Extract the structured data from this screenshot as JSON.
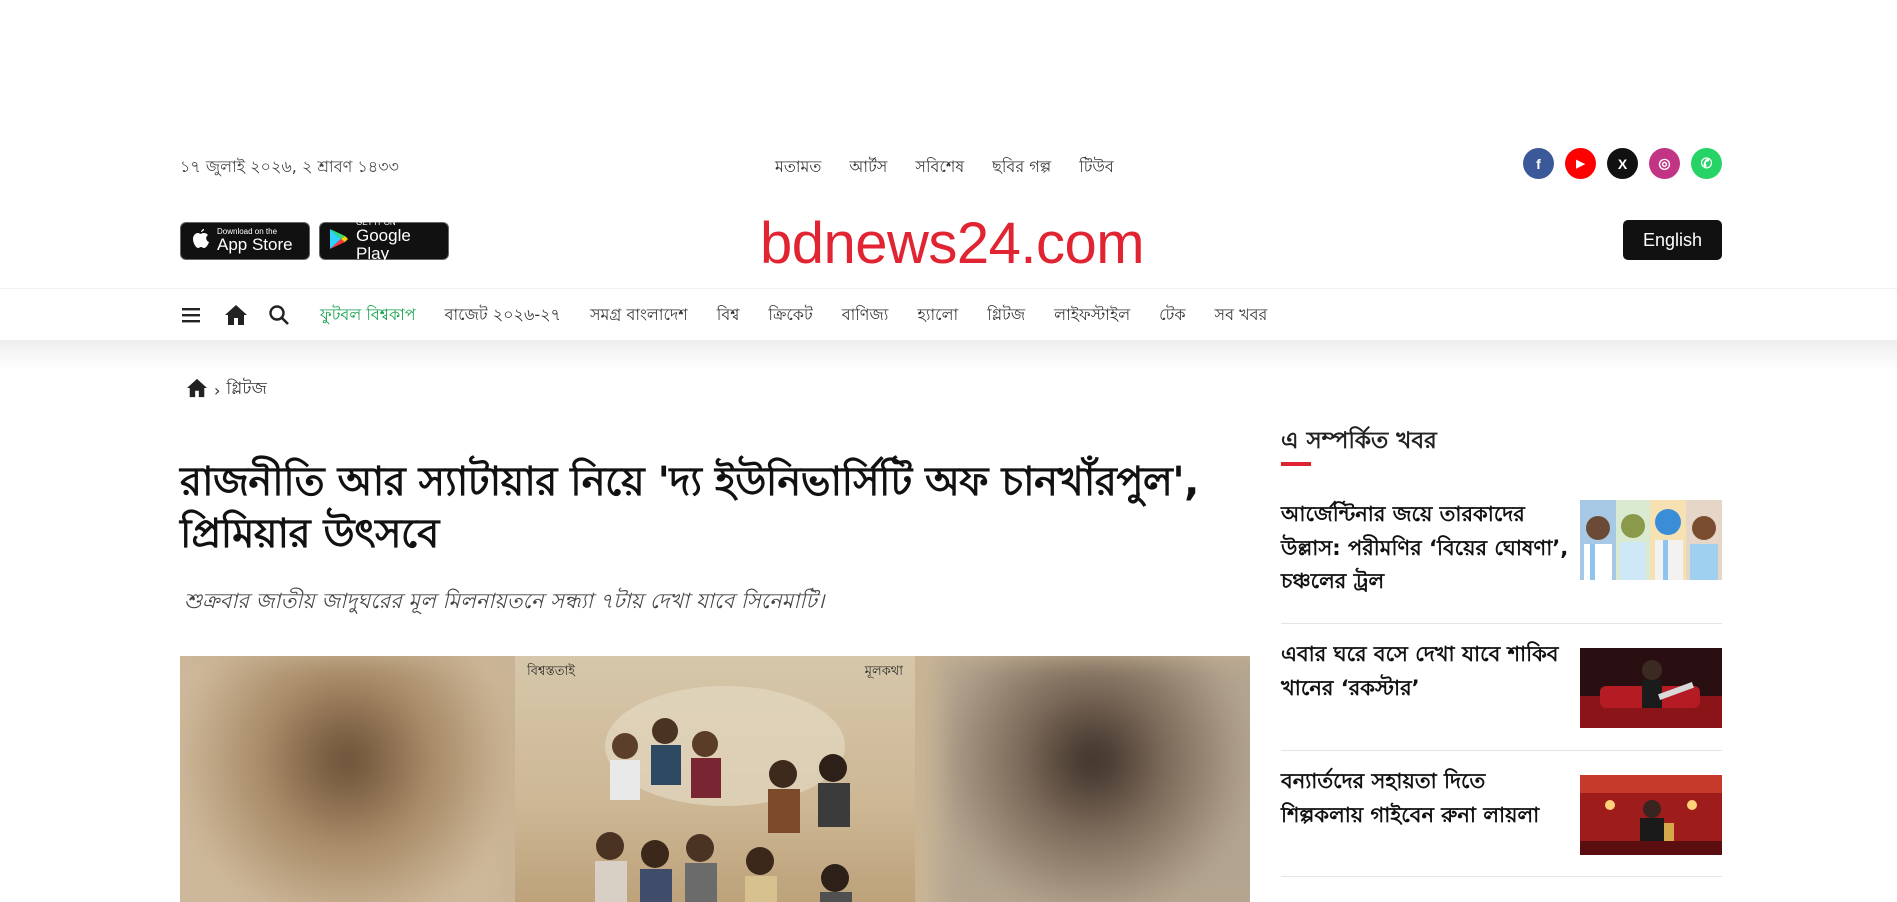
{
  "utility": {
    "date": "১৭ জুলাই ২০২৬, ২ শ্রাবণ ১৪৩৩",
    "links": [
      "মতামত",
      "আর্টস",
      "সবিশেষ",
      "ছবির গল্প",
      "টিউব"
    ],
    "socials": [
      {
        "name": "facebook",
        "glyph": "f",
        "color": "#3b5998"
      },
      {
        "name": "youtube",
        "glyph": "▶",
        "color": "#ff0000"
      },
      {
        "name": "x",
        "glyph": "X",
        "color": "#111111"
      },
      {
        "name": "instagram",
        "glyph": "◎",
        "color": "#c13584"
      },
      {
        "name": "whatsapp",
        "glyph": "✆",
        "color": "#25d366"
      }
    ]
  },
  "masthead": {
    "appstore": {
      "small": "Download on the",
      "big": "App Store"
    },
    "googleplay": {
      "small": "GET IT ON",
      "big": "Google Play"
    },
    "logo": "bdnews24.com",
    "english_button": "English"
  },
  "nav": {
    "items": [
      {
        "label": "ফুটবল বিশ্বকাপ",
        "highlight": true
      },
      {
        "label": "বাজেট ২০২৬-২৭"
      },
      {
        "label": "সমগ্র বাংলাদেশ"
      },
      {
        "label": "বিশ্ব"
      },
      {
        "label": "ক্রিকেট"
      },
      {
        "label": "বাণিজ্য"
      },
      {
        "label": "হ্যালো"
      },
      {
        "label": "গ্লিটজ"
      },
      {
        "label": "লাইফস্টাইল"
      },
      {
        "label": "টেক"
      },
      {
        "label": "সব খবর"
      }
    ],
    "accent": "#12a04a"
  },
  "breadcrumb": {
    "section": "গ্লিটজ"
  },
  "article": {
    "headline": "রাজনীতি আর স্যাটায়ার নিয়ে 'দ্য ইউনিভার্সিটি অফ চানখাঁরপুল', প্রিমিয়ার উৎসবে",
    "subheadline": "শুক্রবার জাতীয় জাদুঘরের মূল মিলনায়তনে সন্ধ্যা ৭টায় দেখা যাবে সিনেমাটি।",
    "poster_left": "বিশ্বস্ততাই",
    "poster_right": "মূলকথা"
  },
  "sidebar": {
    "title": "এ সম্পর্কিত খবর",
    "items": [
      {
        "title": "আর্জেন্টিনার জয়ে তারকাদের উল্লাস: পরীমণির ‘বিয়ের ঘোষণা’, চঞ্চলের ট্রল"
      },
      {
        "title": "এবার ঘরে বসে দেখা যাবে শাকিব খানের ‘রকস্টার’"
      },
      {
        "title": "বন্যার্তদের সহায়তা দিতে শিল্পকলায় গাইবেন রুনা লায়লা"
      }
    ]
  },
  "colors": {
    "brand": "#e02431",
    "dark": "#111111"
  }
}
